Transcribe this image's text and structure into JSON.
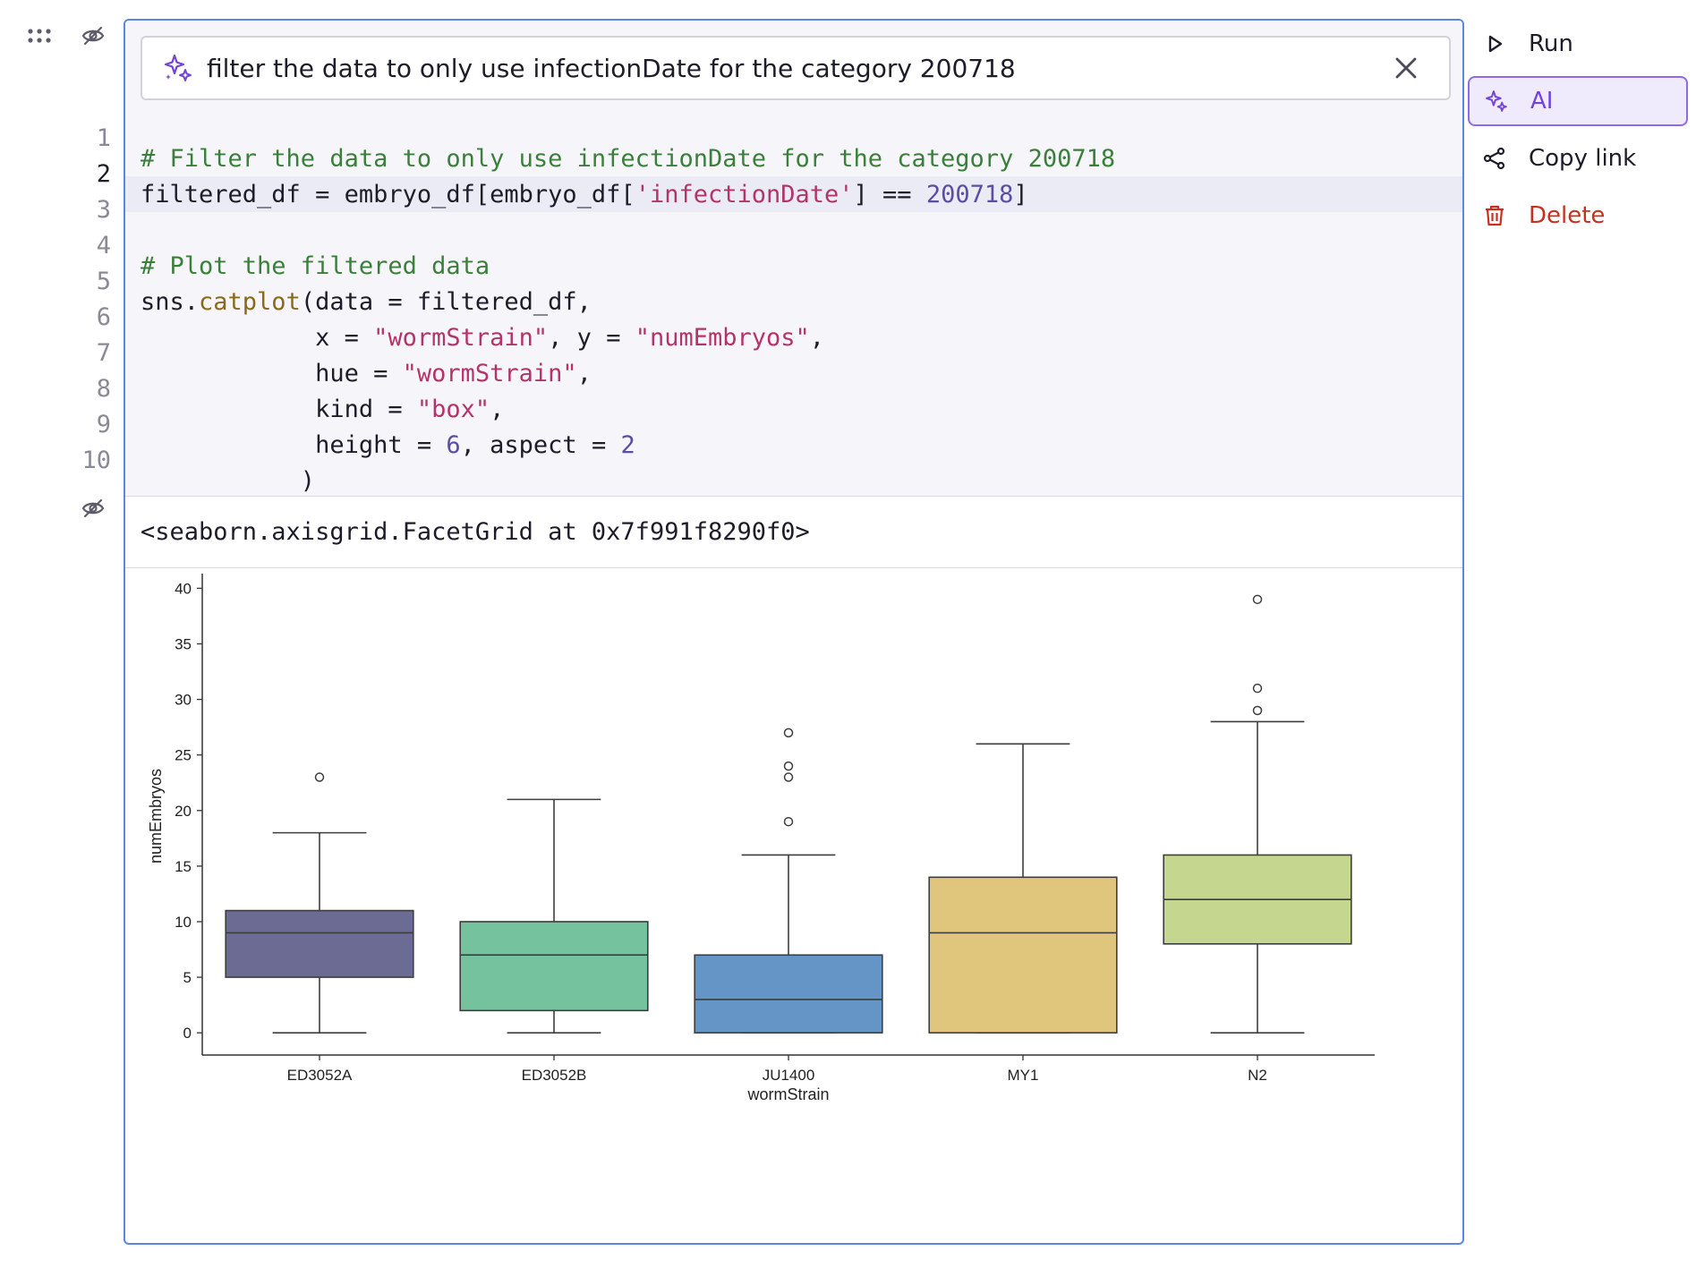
{
  "cell": {
    "ai_prompt": {
      "value": "filter the data to only use infectionDate for the category 200718",
      "icon": "sparkle-icon",
      "close_icon": "close-icon"
    },
    "code_lines": [
      {
        "num": "1",
        "parts": [
          {
            "t": "# Filter the data to only use infectionDate for the category 200718",
            "c": "c-comment"
          }
        ]
      },
      {
        "num": "2",
        "active": true,
        "parts": [
          {
            "t": "filtered_df = embryo_df[embryo_df[",
            "c": ""
          },
          {
            "t": "'infectionDate'",
            "c": "c-str"
          },
          {
            "t": "] == ",
            "c": ""
          },
          {
            "t": "200718",
            "c": "c-num"
          },
          {
            "t": "]",
            "c": ""
          }
        ]
      },
      {
        "num": "3",
        "parts": []
      },
      {
        "num": "4",
        "parts": [
          {
            "t": "# Plot the filtered data",
            "c": "c-comment"
          }
        ]
      },
      {
        "num": "5",
        "parts": [
          {
            "t": "sns.",
            "c": ""
          },
          {
            "t": "catplot",
            "c": "c-fn"
          },
          {
            "t": "(data = filtered_df,",
            "c": ""
          }
        ]
      },
      {
        "num": "6",
        "parts": [
          {
            "t": "            x = ",
            "c": ""
          },
          {
            "t": "\"wormStrain\"",
            "c": "c-str"
          },
          {
            "t": ", y = ",
            "c": ""
          },
          {
            "t": "\"numEmbryos\"",
            "c": "c-str"
          },
          {
            "t": ",",
            "c": ""
          }
        ]
      },
      {
        "num": "7",
        "parts": [
          {
            "t": "            hue = ",
            "c": ""
          },
          {
            "t": "\"wormStrain\"",
            "c": "c-str"
          },
          {
            "t": ",",
            "c": ""
          }
        ]
      },
      {
        "num": "8",
        "parts": [
          {
            "t": "            kind = ",
            "c": ""
          },
          {
            "t": "\"box\"",
            "c": "c-str"
          },
          {
            "t": ",",
            "c": ""
          }
        ]
      },
      {
        "num": "9",
        "parts": [
          {
            "t": "            height = ",
            "c": ""
          },
          {
            "t": "6",
            "c": "c-num"
          },
          {
            "t": ", aspect = ",
            "c": ""
          },
          {
            "t": "2",
            "c": "c-num"
          }
        ]
      },
      {
        "num": "10",
        "parts": [
          {
            "t": "           )",
            "c": ""
          }
        ]
      }
    ],
    "output_text": "<seaborn.axisgrid.FacetGrid at 0x7f991f8290f0>"
  },
  "menu": {
    "run": {
      "label": "Run",
      "icon": "play-icon"
    },
    "ai": {
      "label": "AI",
      "icon": "sparkle-icon"
    },
    "copy_link": {
      "label": "Copy link",
      "icon": "share-icon"
    },
    "delete": {
      "label": "Delete",
      "icon": "trash-icon"
    }
  },
  "gutter": {
    "drag_icon": "drag-handle-icon",
    "hide_code_icon": "eye-off-icon",
    "hide_output_icon": "eye-off-icon"
  },
  "chart_data": {
    "type": "box",
    "title": "",
    "xlabel": "wormStrain",
    "ylabel": "numEmbryos",
    "ylim": [
      -2,
      41
    ],
    "yticks": [
      0,
      5,
      10,
      15,
      20,
      25,
      30,
      35,
      40
    ],
    "categories": [
      "ED3052A",
      "ED3052B",
      "JU1400",
      "MY1",
      "N2"
    ],
    "series": [
      {
        "name": "ED3052A",
        "color": "#6c6b93",
        "whisker_low": 0,
        "q1": 5,
        "median": 9,
        "q3": 11,
        "whisker_high": 18,
        "outliers": [
          23
        ]
      },
      {
        "name": "ED3052B",
        "color": "#74c39e",
        "whisker_low": 0,
        "q1": 2,
        "median": 7,
        "q3": 10,
        "whisker_high": 21,
        "outliers": []
      },
      {
        "name": "JU1400",
        "color": "#6594c6",
        "whisker_low": 0,
        "q1": 0,
        "median": 3,
        "q3": 7,
        "whisker_high": 16,
        "outliers": [
          19,
          23,
          24,
          27
        ]
      },
      {
        "name": "MY1",
        "color": "#e0c67d",
        "whisker_low": 0,
        "q1": 0,
        "median": 9,
        "q3": 14,
        "whisker_high": 26,
        "outliers": []
      },
      {
        "name": "N2",
        "color": "#c5d68e",
        "whisker_low": 0,
        "q1": 8,
        "median": 12,
        "q3": 16,
        "whisker_high": 28,
        "outliers": [
          29,
          31,
          39
        ]
      }
    ],
    "grid": false,
    "legend": "none"
  }
}
